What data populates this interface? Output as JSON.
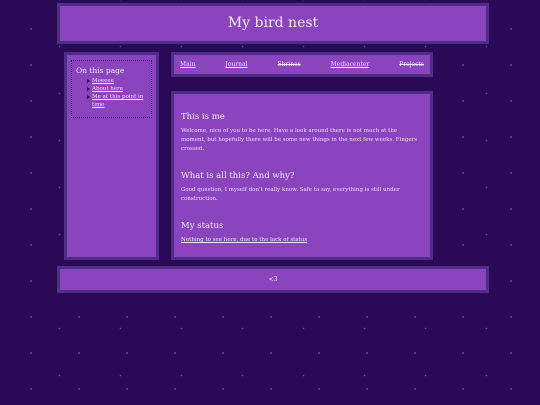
{
  "header": {
    "title": "My bird nest"
  },
  "sidebar": {
    "heading": "On this page",
    "items": [
      {
        "label": "Meeeee"
      },
      {
        "label": "About here"
      },
      {
        "label": "Me at this point in time"
      }
    ]
  },
  "nav": {
    "items": [
      {
        "label": "Main"
      },
      {
        "label": "Journal"
      },
      {
        "label": "Shrines"
      },
      {
        "label": "Mediacenter"
      },
      {
        "label": "Projects"
      }
    ]
  },
  "main": {
    "sections": [
      {
        "heading": "This is me",
        "body": "Welcome, nice of you to be here. Have a look around there is not much at the moment, but hopefully there will be some new things in the next few weeks. Fingers crossed."
      },
      {
        "heading": "What is all this? And why?",
        "body": "Good question, I myself don't really know. Safe to say, everything is still under construction."
      },
      {
        "heading": "My status",
        "body": "Nothing to see here, due to the lack of status"
      }
    ]
  },
  "footer": {
    "text": "<3"
  },
  "colors": {
    "background": "#2a0a57",
    "panel": "#8a44bd",
    "border": "#4e2e86"
  }
}
